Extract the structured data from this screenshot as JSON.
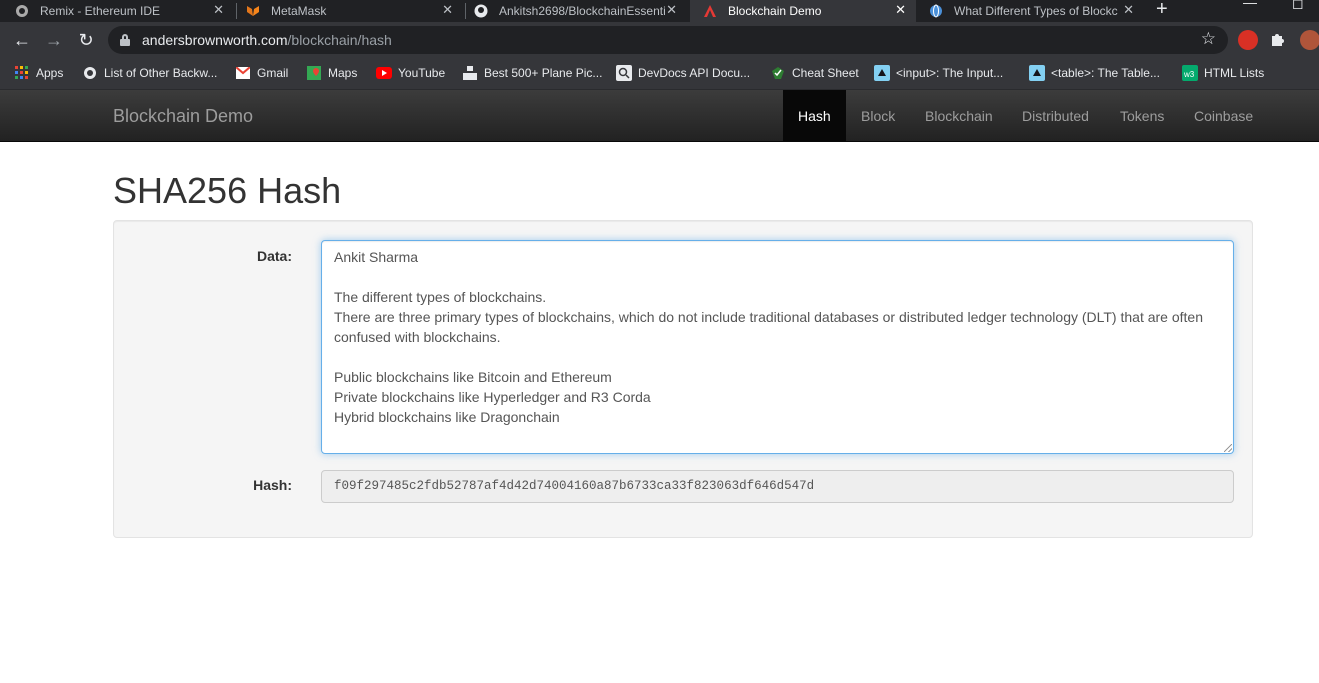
{
  "browser": {
    "tabs": [
      {
        "title": "Remix - Ethereum IDE",
        "icon": "remix-icon"
      },
      {
        "title": "MetaMask",
        "icon": "metamask-fox-icon"
      },
      {
        "title": "Ankitsh2698/BlockchainEssenti",
        "icon": "github-icon"
      },
      {
        "title": "Blockchain Demo",
        "icon": "blockchain-demo-icon"
      },
      {
        "title": "What Different Types of Blockc",
        "icon": "globe-icon"
      }
    ],
    "active_tab": 3,
    "url_domain": "andersbrownworth.com",
    "url_path": "/blockchain/hash",
    "bookmarks": [
      {
        "label": "Apps",
        "icon": "apps-grid-icon"
      },
      {
        "label": "List of Other Backw...",
        "icon": "globe-icon"
      },
      {
        "label": "Gmail",
        "icon": "gmail-icon"
      },
      {
        "label": "Maps",
        "icon": "maps-icon"
      },
      {
        "label": "YouTube",
        "icon": "youtube-icon"
      },
      {
        "label": "Best 500+ Plane Pic...",
        "icon": "unsplash-icon"
      },
      {
        "label": "DevDocs API Docu...",
        "icon": "devdocs-icon"
      },
      {
        "label": "Cheat Sheet",
        "icon": "cheatsheet-icon"
      },
      {
        "label": "<input>: The Input...",
        "icon": "mdn-icon"
      },
      {
        "label": "<table>: The Table...",
        "icon": "mdn-icon"
      },
      {
        "label": "HTML Lists",
        "icon": "w3schools-icon"
      }
    ]
  },
  "navbar": {
    "brand": "Blockchain Demo",
    "links": [
      "Hash",
      "Block",
      "Blockchain",
      "Distributed",
      "Tokens",
      "Coinbase"
    ],
    "active": "Hash"
  },
  "main": {
    "title": "SHA256 Hash",
    "data_label": "Data:",
    "data_value": "Ankit Sharma\n\nThe different types of blockchains.\nThere are three primary types of blockchains, which do not include traditional databases or distributed ledger technology (DLT) that are often confused with blockchains.\n\nPublic blockchains like Bitcoin and Ethereum\nPrivate blockchains like Hyperledger and R3 Corda\nHybrid blockchains like Dragonchain",
    "hash_label": "Hash:",
    "hash_value": "f09f297485c2fdb52787af4d42d74004160a87b6733ca33f823063df646d547d"
  },
  "colors": {
    "navbar_dark": "#222222",
    "active_link_bg": "#080808",
    "focus_border": "#66afe9",
    "well_bg": "#f5f5f5"
  }
}
